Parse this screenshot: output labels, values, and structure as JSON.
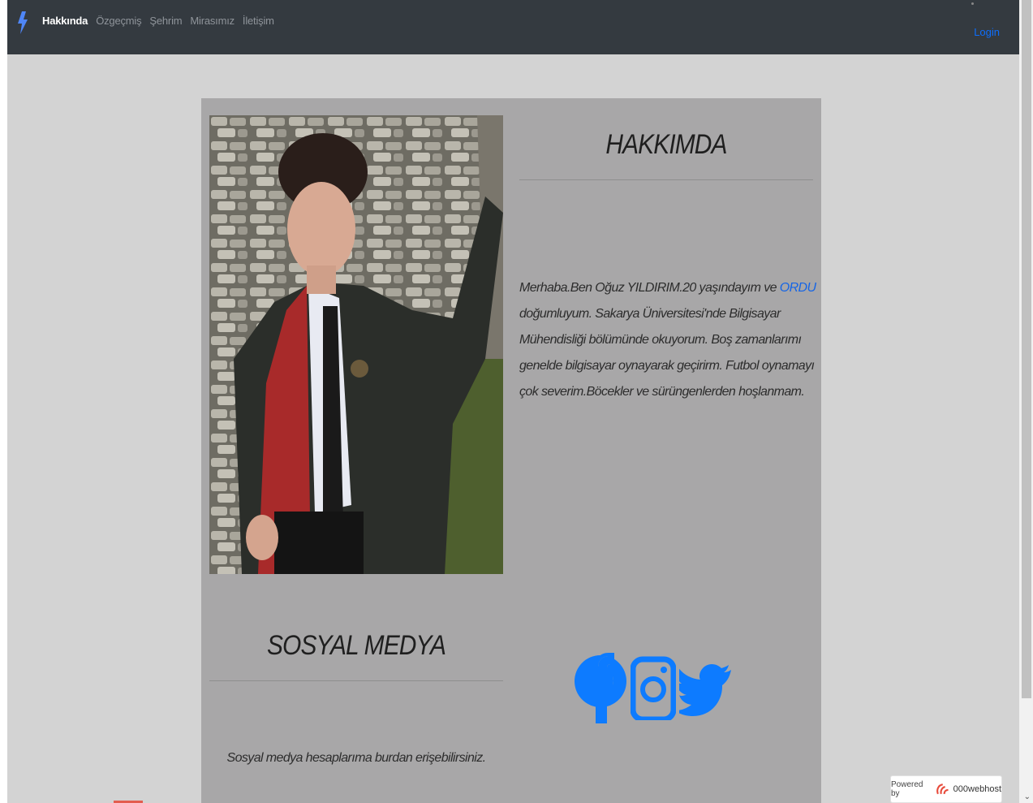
{
  "navbar": {
    "brand_icon": "lightning-bolt-icon",
    "links": [
      "Hakkında",
      "Özgeçmiş",
      "Şehrim",
      "Mirasımız",
      "İletişim"
    ],
    "active_link": "Hakkında",
    "login_label": "Login"
  },
  "about": {
    "title": "HAKKIMDA",
    "text_before_link": "Merhaba.Ben Oğuz YILDIRIM.20 yaşındayım ve ",
    "city_link": "ORDU",
    "text_after_link": " doğumluyum. Sakarya Üniversitesi'nde Bilgisayar Mühendisliği bölümünde okuyorum. Boş zamanlarımı genelde bilgisayar oynayarak geçirirm. Futbol oynamayı çok severim.Böcekler ve sürüngenlerden hoşlanmam."
  },
  "social": {
    "title": "SOSYAL MEDYA",
    "text": "Sosyal medya hesaplarıma burdan erişebilirsiniz.",
    "icons": [
      "facebook-icon",
      "instagram-icon",
      "twitter-icon"
    ],
    "icon_color": "#0d7bff"
  },
  "footer": {
    "powered_by": "Powered by",
    "host": "000webhost"
  }
}
